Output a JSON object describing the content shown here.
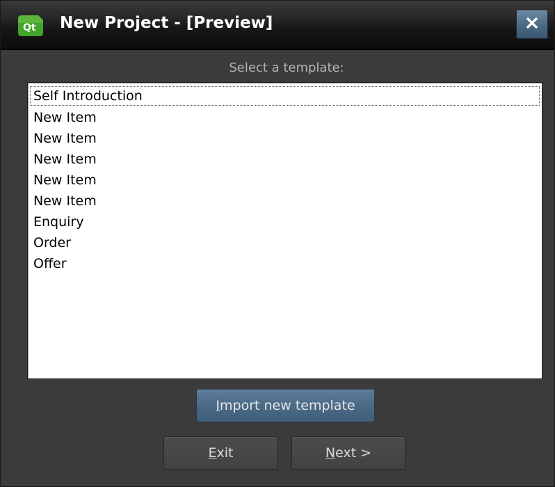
{
  "window": {
    "title": "New Project - [Preview]",
    "close_glyph": "✕",
    "icon": "qt-app-icon"
  },
  "prompt": "Select a template:",
  "templates": [
    "Self Introduction",
    "New Item",
    "New Item",
    "New Item",
    "New Item",
    "New Item",
    "Enquiry",
    "Order",
    "Offer"
  ],
  "current_template_index": 0,
  "buttons": {
    "import": {
      "mnemonic": "I",
      "rest": "mport new template"
    },
    "exit": {
      "mnemonic": "E",
      "rest": "xit"
    },
    "next": {
      "mnemonic": "N",
      "rest": "ext >"
    }
  },
  "colors": {
    "background": "#3b3b3b",
    "accent_button": "#4a6a86",
    "list_background": "#ffffff",
    "app_icon_green": "#41a62a"
  }
}
